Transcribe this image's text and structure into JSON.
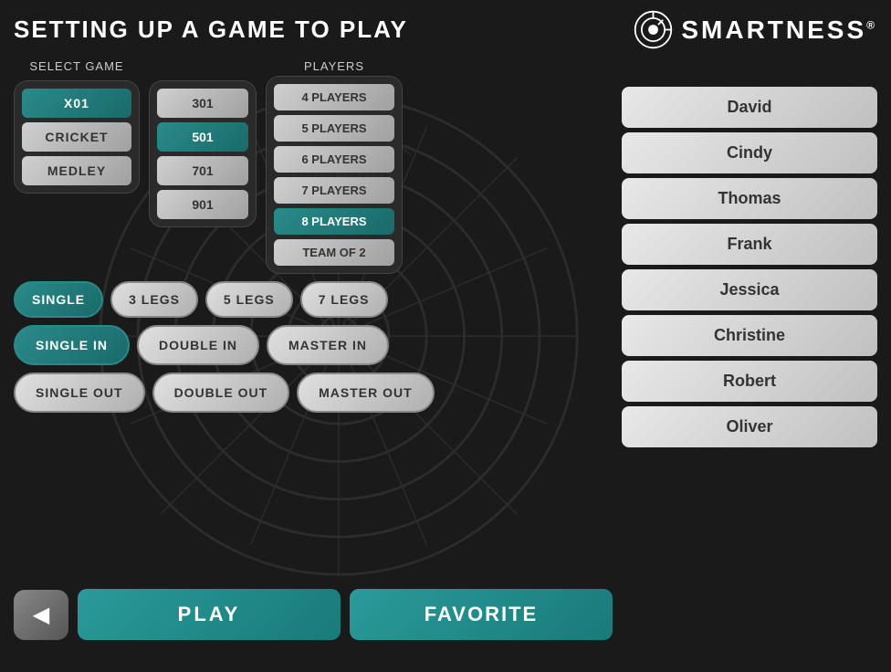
{
  "header": {
    "title": "SETTING UP A GAME TO PLAY",
    "logo_text": "SMARTNESS",
    "logo_reg": "®"
  },
  "select_game": {
    "label": "SELECT GAME",
    "games": [
      {
        "label": "X01",
        "active": true
      },
      {
        "label": "CRICKET",
        "active": false
      },
      {
        "label": "MEDLEY",
        "active": false
      }
    ],
    "numbers": [
      {
        "label": "301",
        "active": false
      },
      {
        "label": "501",
        "active": true
      },
      {
        "label": "701",
        "active": false
      },
      {
        "label": "901",
        "active": false
      }
    ]
  },
  "players": {
    "label": "PLAYERS",
    "counts": [
      {
        "label": "4 PLAYERS",
        "active": false
      },
      {
        "label": "5 PLAYERS",
        "active": false
      },
      {
        "label": "6 PLAYERS",
        "active": false
      },
      {
        "label": "7 PLAYERS",
        "active": false
      },
      {
        "label": "8 PLAYERS",
        "active": true
      },
      {
        "label": "TEAM OF 2",
        "active": false
      }
    ]
  },
  "legs": {
    "options": [
      {
        "label": "SINGLE",
        "active": true
      },
      {
        "label": "3 LEGS",
        "active": false
      },
      {
        "label": "5 LEGS",
        "active": false
      },
      {
        "label": "7 LEGS",
        "active": false
      }
    ]
  },
  "in_options": [
    {
      "label": "SINGLE IN",
      "active": true
    },
    {
      "label": "DOUBLE IN",
      "active": false
    },
    {
      "label": "MASTER IN",
      "active": false
    }
  ],
  "out_options": [
    {
      "label": "SINGLE OUT",
      "active": false
    },
    {
      "label": "DOUBLE OUT",
      "active": false
    },
    {
      "label": "MASTER OUT",
      "active": false
    }
  ],
  "buttons": {
    "back": "◀",
    "play": "PLAY",
    "favorite": "FAVORITE"
  },
  "player_list": [
    {
      "name": "David"
    },
    {
      "name": "Cindy"
    },
    {
      "name": "Thomas"
    },
    {
      "name": "Frank"
    },
    {
      "name": "Jessica"
    },
    {
      "name": "Christine"
    },
    {
      "name": "Robert"
    },
    {
      "name": "Oliver"
    }
  ]
}
